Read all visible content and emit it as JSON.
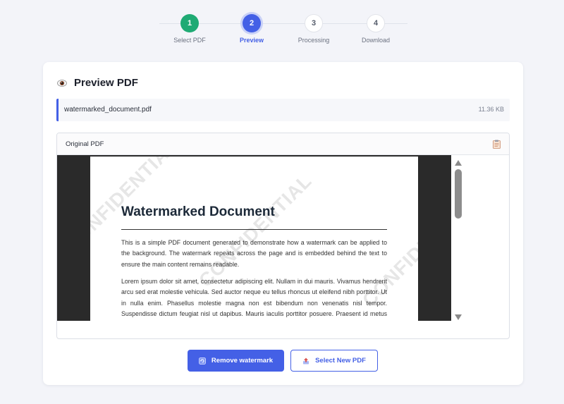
{
  "stepper": {
    "steps": [
      {
        "number": "1",
        "label": "Select PDF",
        "state": "done"
      },
      {
        "number": "2",
        "label": "Preview",
        "state": "active"
      },
      {
        "number": "3",
        "label": "Processing",
        "state": "todo"
      },
      {
        "number": "4",
        "label": "Download",
        "state": "todo"
      }
    ]
  },
  "card": {
    "title": "Preview PDF",
    "title_icon": "eye-icon"
  },
  "file": {
    "name": "watermarked_document.pdf",
    "size": "11.36 KB"
  },
  "viewer": {
    "title": "Original PDF",
    "copy_icon": "clipboard-icon"
  },
  "pdf": {
    "watermark_text": "CONFIDENTIAL",
    "heading": "Watermarked Document",
    "paragraphs": [
      "This is a simple PDF document generated to demonstrate how a watermark can be applied to the background. The watermark repeats across the page and is embedded behind the text to ensure the main content remains readable.",
      "Lorem ipsum dolor sit amet, consectetur adipiscing elit. Nullam in dui mauris. Vivamus hendrerit arcu sed erat molestie vehicula. Sed auctor neque eu tellus rhoncus ut eleifend nibh porttitor. Ut in nulla enim. Phasellus molestie magna non est bibendum non venenatis nisl tempor. Suspendisse dictum feugiat nisl ut dapibus. Mauris iaculis porttitor posuere. Praesent id metus massa, ut blandit odio. Proin quis tortor orci."
    ]
  },
  "actions": {
    "remove_label": "Remove watermark",
    "select_new_label": "Select New PDF"
  },
  "colors": {
    "accent": "#4460e6",
    "done": "#1faa74",
    "background": "#f3f4f9"
  }
}
